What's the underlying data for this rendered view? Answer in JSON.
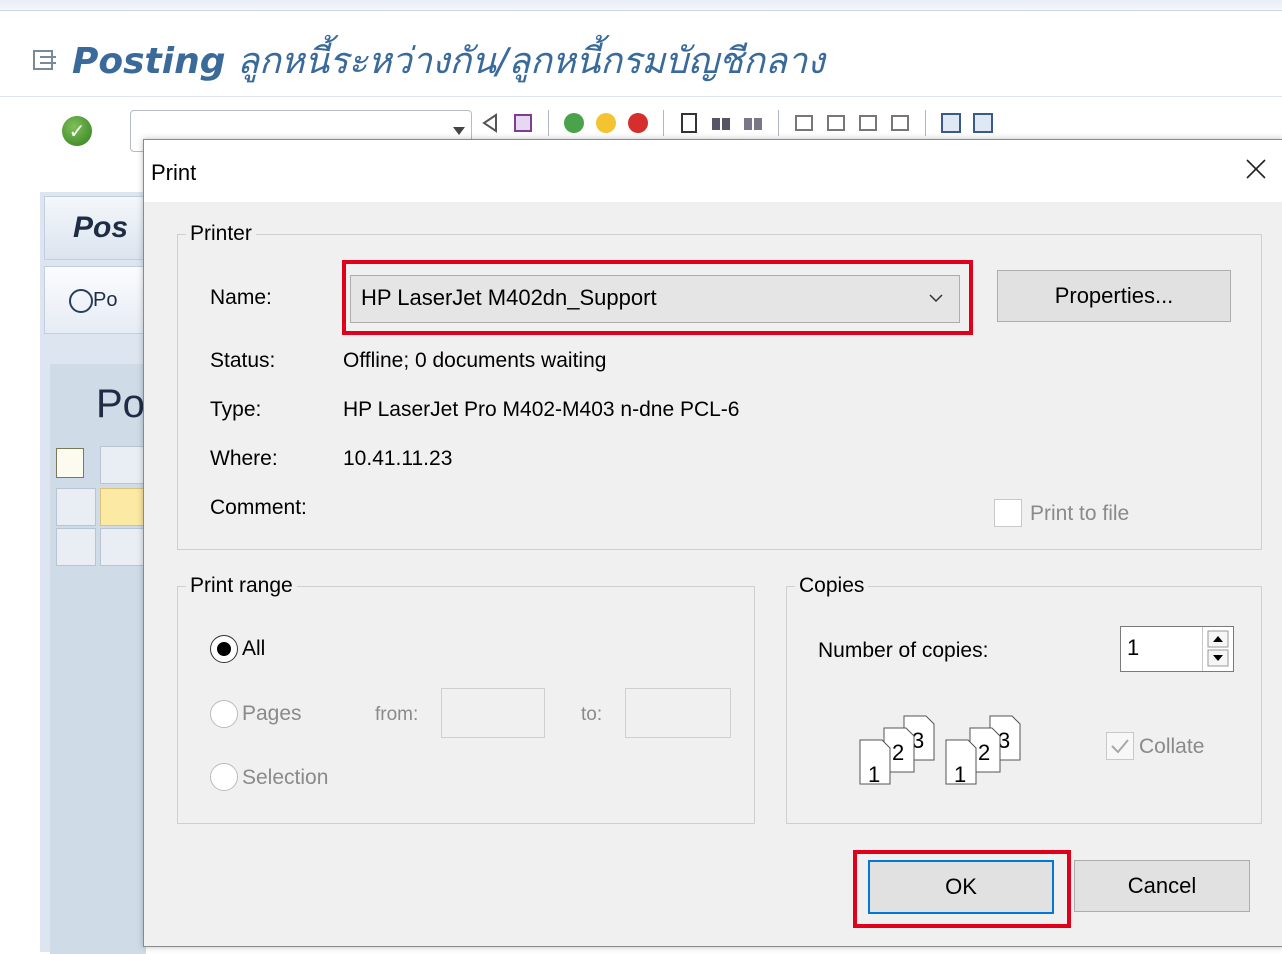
{
  "sap": {
    "title_bold": "Posting",
    "title_rest": " ลูกหนี้ระหว่างกัน/ลูกหนี้กรมบัญชีกลาง",
    "left_header": "Pos",
    "left_button": "Po",
    "area_title": "Po"
  },
  "dialog": {
    "title": "Print",
    "printer_group": "Printer",
    "name_label": "Name:",
    "printer_name": "HP LaserJet M402dn_Support",
    "properties_button": "Properties...",
    "status_label": "Status:",
    "status_value": "Offline; 0 documents waiting",
    "type_label": "Type:",
    "type_value": "HP LaserJet Pro M402-M403 n-dne PCL-6",
    "where_label": "Where:",
    "where_value": "10.41.11.23",
    "comment_label": "Comment:",
    "print_to_file": "Print to file",
    "range_group": "Print range",
    "range_all": "All",
    "range_pages": "Pages",
    "from_label": "from:",
    "to_label": "to:",
    "range_selection": "Selection",
    "copies_group": "Copies",
    "copies_label": "Number of copies:",
    "copies_value": "1",
    "collate_label": "Collate",
    "ok_button": "OK",
    "cancel_button": "Cancel"
  },
  "collate_pages": [
    "1",
    "2",
    "3"
  ],
  "colors": {
    "highlight": "#e0001a",
    "focus": "#0078d7",
    "sap_title": "#3a6a9a"
  }
}
